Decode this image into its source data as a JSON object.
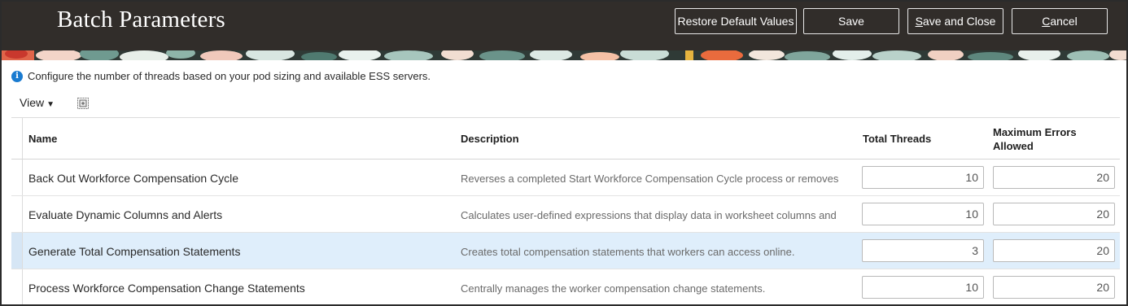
{
  "header": {
    "title": "Batch Parameters",
    "buttons": {
      "restore": "Restore Default Values",
      "save": "Save",
      "save_close_first": "S",
      "save_close_rest": "ave and Close",
      "cancel_first": "C",
      "cancel_rest": "ancel"
    }
  },
  "info": {
    "icon": "info-icon",
    "text": "Configure the number of threads based on your pod sizing and available ESS servers."
  },
  "toolbar": {
    "view_label": "View",
    "detach_icon": "detach-icon"
  },
  "table": {
    "columns": {
      "name": "Name",
      "description": "Description",
      "threads": "Total Threads",
      "errors_line1": "Maximum Errors",
      "errors_line2": "Allowed"
    },
    "rows": [
      {
        "name": "Back Out Workforce Compensation Cycle",
        "description": "Reverses a completed Start Workforce Compensation Cycle process or removes",
        "threads": "10",
        "errors": "20",
        "selected": false
      },
      {
        "name": "Evaluate Dynamic Columns and Alerts",
        "description": "Calculates user-defined expressions that display data in worksheet columns and",
        "threads": "10",
        "errors": "20",
        "selected": false
      },
      {
        "name": "Generate Total Compensation Statements",
        "description": "Creates total compensation statements that workers can access online.",
        "threads": "3",
        "errors": "20",
        "selected": true
      },
      {
        "name": "Process Workforce Compensation Change Statements",
        "description": "Centrally manages the worker compensation change statements.",
        "threads": "10",
        "errors": "20",
        "selected": false
      }
    ]
  },
  "colors": {
    "header_bg": "#312d2a",
    "selected_row": "#dfeefb",
    "info_blue": "#1a7bd0"
  }
}
